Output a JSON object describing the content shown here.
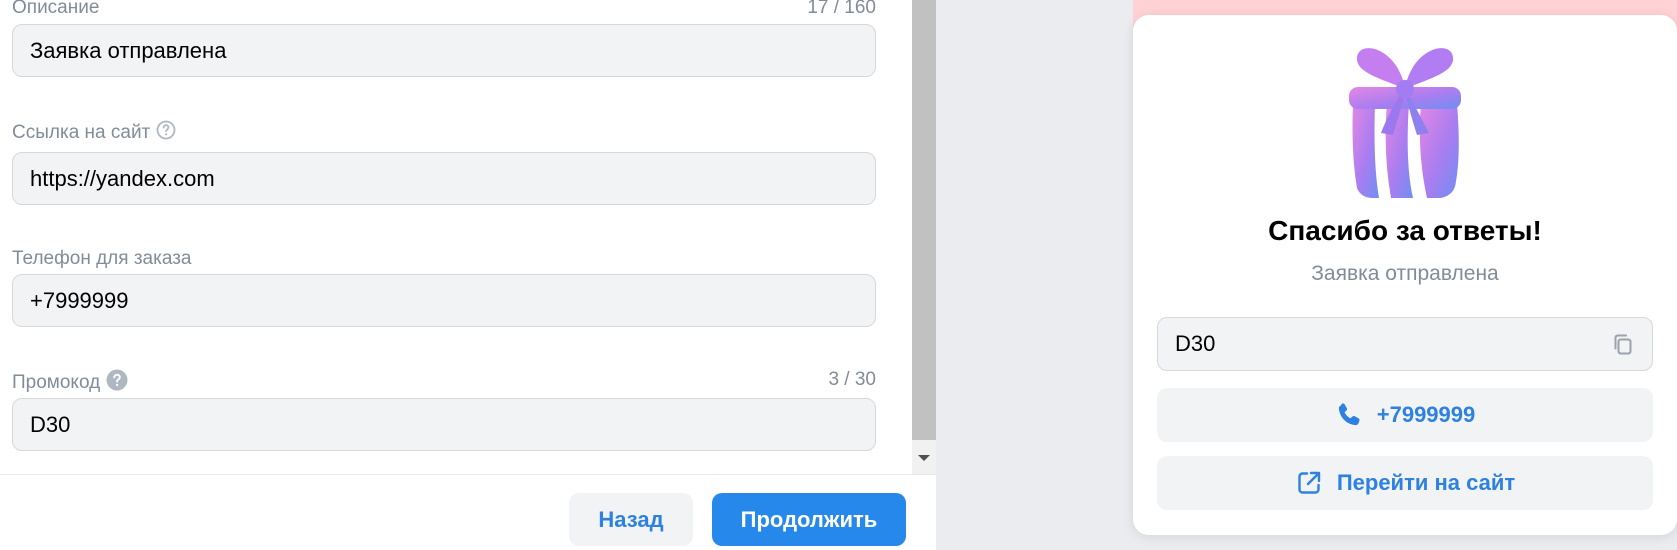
{
  "form": {
    "description": {
      "label": "Описание",
      "counter": "17 / 160",
      "value": "Заявка отправлена"
    },
    "site_link": {
      "label": "Ссылка на сайт",
      "value": "https://yandex.com"
    },
    "phone": {
      "label": "Телефон для заказа",
      "value": "+7999999"
    },
    "promo": {
      "label": "Промокод",
      "counter": "3 / 30",
      "value": "D30"
    }
  },
  "footer": {
    "back_label": "Назад",
    "continue_label": "Продолжить"
  },
  "preview": {
    "title": "Спасибо за ответы!",
    "subtitle": "Заявка отправлена",
    "promo_code": "D30",
    "phone_label": "+7999999",
    "site_label": "Перейти на сайт"
  },
  "icons": {
    "site_help": "help-outline-icon",
    "promo_help": "help-filled-icon",
    "copy": "copy-icon",
    "phone": "phone-icon",
    "external": "external-link-icon",
    "gift": "gift-icon"
  },
  "colors": {
    "accent": "#2688eb",
    "accent_text": "#2d81e0",
    "muted_text": "#818c99",
    "field_bg": "#f2f3f5",
    "preview_bg": "#ebecef",
    "card_header_pink": "#ffd3d6"
  }
}
